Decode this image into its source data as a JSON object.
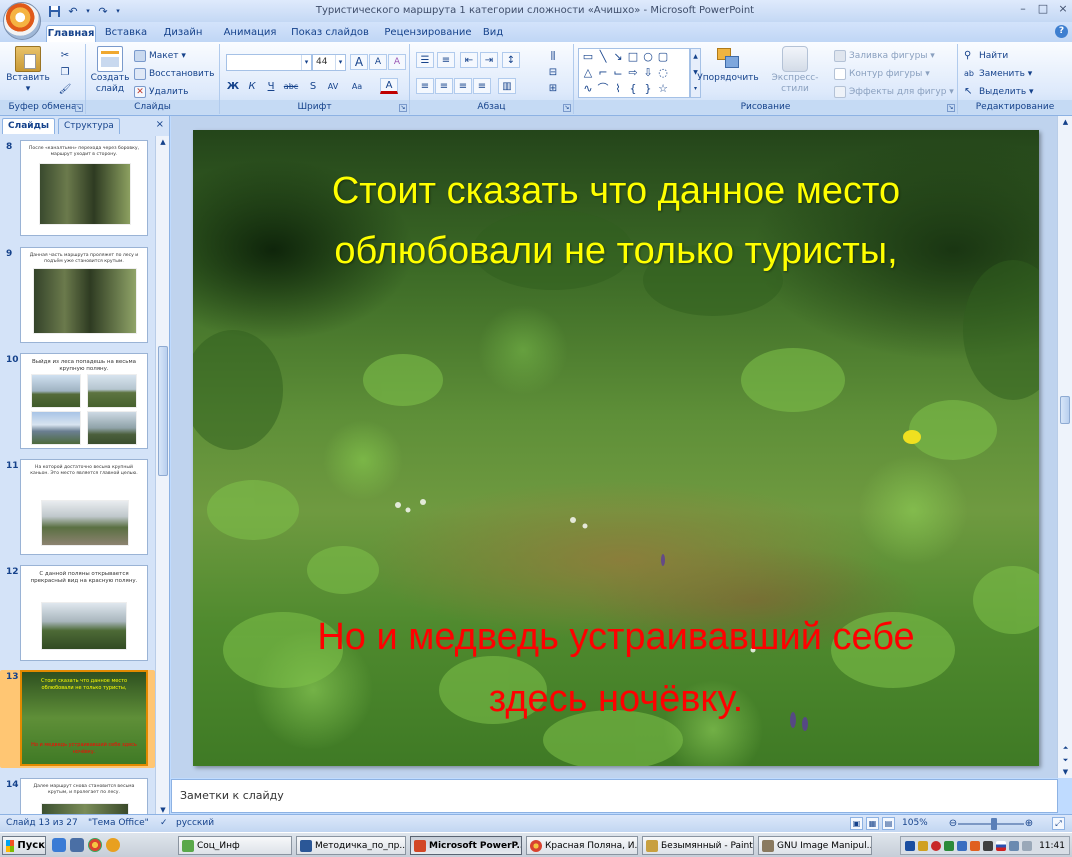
{
  "window": {
    "title": "Туристического маршрута 1 категории сложности «Ачишхо» - Microsoft PowerPoint",
    "controls": [
      "–",
      "□",
      "×"
    ]
  },
  "qat": {
    "save_icon": "save-icon",
    "undo_icon": "undo-icon",
    "redo_icon": "redo-icon"
  },
  "ribbon_tabs": [
    "Главная",
    "Вставка",
    "Дизайн",
    "Анимация",
    "Показ слайдов",
    "Рецензирование",
    "Вид"
  ],
  "ribbon": {
    "clipboard": {
      "label": "Буфер обмена",
      "paste": "Вставить",
      "paste_arrow": "▾"
    },
    "slides": {
      "label": "Слайды",
      "new_slide": "Создать слайд",
      "layout": "Макет ▾",
      "reset": "Восстановить",
      "delete": "Удалить"
    },
    "font": {
      "label": "Шрифт",
      "font_name": "",
      "font_size": "44",
      "grow": "A",
      "shrink": "A",
      "clear": "A",
      "bold": "Ж",
      "italic": "К",
      "underline": "Ч",
      "strike": "abc",
      "shadow": "S",
      "spacing": "AV",
      "case": "Aa",
      "color": "A"
    },
    "paragraph": {
      "label": "Абзац"
    },
    "drawing": {
      "label": "Рисование",
      "arrange": "Упорядочить",
      "quick_styles": "Экспресс-стили",
      "shape_fill": "Заливка фигуры ▾",
      "shape_outline": "Контур фигуры ▾",
      "shape_effects": "Эффекты для фигур ▾"
    },
    "editing": {
      "label": "Редактирование",
      "find": "Найти",
      "replace": "Заменить ▾",
      "select": "Выделить ▾"
    }
  },
  "pane": {
    "tabs": [
      "Слайды",
      "Структура"
    ],
    "close": "×",
    "slides": [
      {
        "num": "8",
        "text": "После «каналтьмн» перехода через боровку, маршрут уходит в сторону."
      },
      {
        "num": "9",
        "text": "Данная часть маршрута проляжет по лесу и подъём уже становится крутым."
      },
      {
        "num": "10",
        "text": "Выйдя из леса попадешь на весьма крупную поляну."
      },
      {
        "num": "11",
        "text": "На которой достаточно весьма крупный каньон. Это место является главной целью."
      },
      {
        "num": "12",
        "text": "С данной поляны открывается прекрасный вид на красную поляну."
      },
      {
        "num": "13",
        "text_top": "Стоит сказать что данное место облюбовали не только туристы,",
        "text_bottom": "Но и медведь устраивавший себе здесь ночёвку."
      },
      {
        "num": "14",
        "text": "Далее маршрут снова становится весьма крутым, и пролегает по лесу."
      }
    ]
  },
  "slide": {
    "line1": "Стоит сказать что данное место",
    "line2": "облюбовали не только туристы,",
    "line3": "Но и медведь устраивавший себе",
    "line4": "здесь ночёвку."
  },
  "notes": {
    "placeholder": "Заметки к слайду"
  },
  "status": {
    "slide_info": "Слайд 13 из 27",
    "theme": "\"Тема Office\"",
    "language": "русский",
    "zoom": "105%",
    "zoom_fraction": 0.55
  },
  "taskbar": {
    "start": "Пуск",
    "tasks": [
      "Соц_Инф",
      "Методичка_по_пр...",
      "Microsoft PowerP...",
      "Красная Поляна, И...",
      "Безымянный - Paint",
      "GNU Image Manipul..."
    ],
    "clock": "11:41"
  },
  "colors": {
    "slide_title": "#ffff00",
    "slide_bottom": "#ff0000",
    "ribbon_text": "#15428b",
    "current_thumb": "#ffc673"
  }
}
